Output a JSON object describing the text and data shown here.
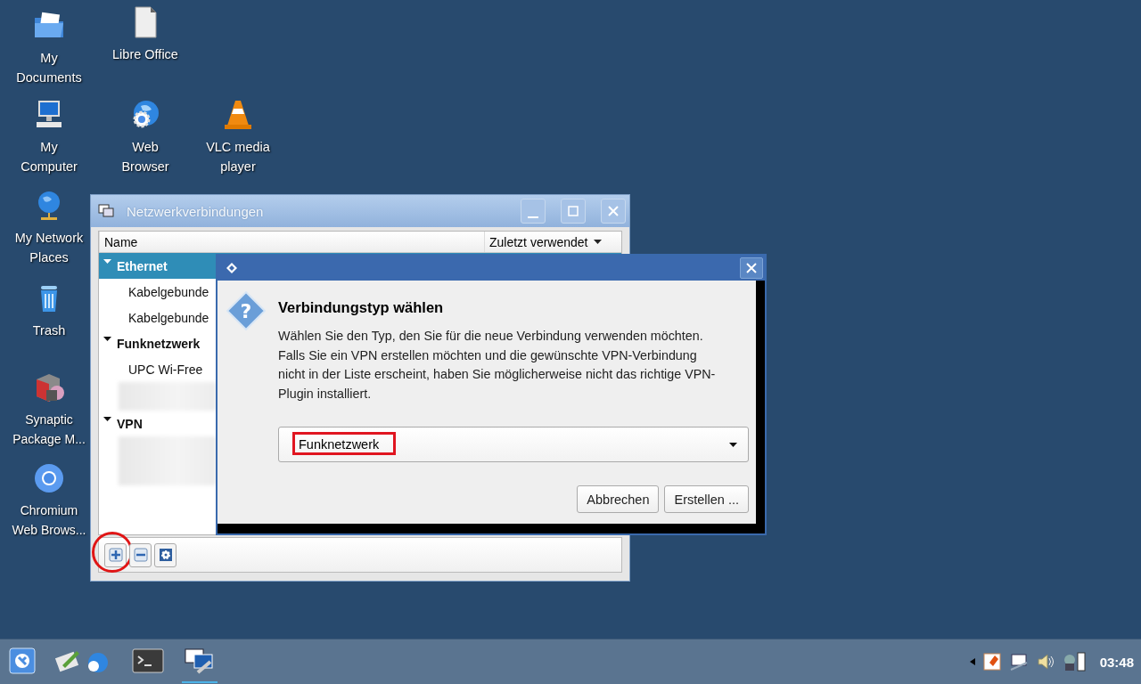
{
  "desktop_icons": [
    {
      "label": "My Documents",
      "kind": "folder"
    },
    {
      "label": "My Computer",
      "kind": "computer"
    },
    {
      "label": "My Network Places",
      "kind": "network"
    },
    {
      "label": "Trash",
      "kind": "trash"
    },
    {
      "label": "Synaptic Package M...",
      "kind": "package"
    },
    {
      "label": "Chromium Web Brows...",
      "kind": "chromium"
    },
    {
      "label": "Libre Office",
      "kind": "document"
    },
    {
      "label": "Web Browser",
      "kind": "globe"
    },
    {
      "label": "VLC media player",
      "kind": "cone"
    }
  ],
  "main_window": {
    "title": "Netzwerkverbindungen",
    "columns": [
      "Name",
      "Zuletzt verwendet"
    ],
    "groups": [
      {
        "label": "Ethernet",
        "expanded": true,
        "selected": true,
        "children": [
          {
            "kind": "text",
            "label": "Kabelgebunde",
            "selected": false
          },
          {
            "kind": "text",
            "label": "Kabelgebunde",
            "selected": false
          }
        ]
      },
      {
        "label": "Funknetzwerk",
        "expanded": true,
        "selected": false,
        "children": [
          {
            "kind": "text",
            "label": "UPC Wi-Free",
            "selected": false
          },
          {
            "kind": "blurred",
            "selected": false
          }
        ]
      },
      {
        "label": "VPN",
        "expanded": true,
        "selected": false,
        "children": [
          {
            "kind": "blurred",
            "selected": false
          }
        ]
      }
    ],
    "toolbar": [
      {
        "kind": "add",
        "circled": true
      },
      {
        "kind": "remove",
        "circled": false
      },
      {
        "kind": "settings",
        "circled": false
      }
    ]
  },
  "dialog": {
    "icon_glyph": "?",
    "heading": "Verbindungstyp wählen",
    "message": "Wählen Sie den Typ, den Sie für die neue Verbindung verwenden möchten. Falls Sie ein VPN erstellen möchten und die gewünschte VPN-Verbindung nicht in der Liste erscheint, haben Sie möglicherweise nicht das richtige VPN-Plugin installiert.",
    "dropdown": {
      "value": "Funknetzwerk",
      "highlighted": true
    },
    "buttons": [
      "Abbrechen",
      "Erstellen ..."
    ]
  },
  "taskbar": {
    "apps": [
      {
        "kind": "start",
        "active": false
      },
      {
        "kind": "tools",
        "active": false
      },
      {
        "kind": "terminal",
        "active": false
      },
      {
        "kind": "network",
        "active": true
      }
    ],
    "tray": [
      {
        "kind": "arrow"
      },
      {
        "kind": "notes"
      },
      {
        "kind": "display"
      },
      {
        "kind": "volume"
      },
      {
        "kind": "battery"
      }
    ],
    "clock": "03:48"
  }
}
